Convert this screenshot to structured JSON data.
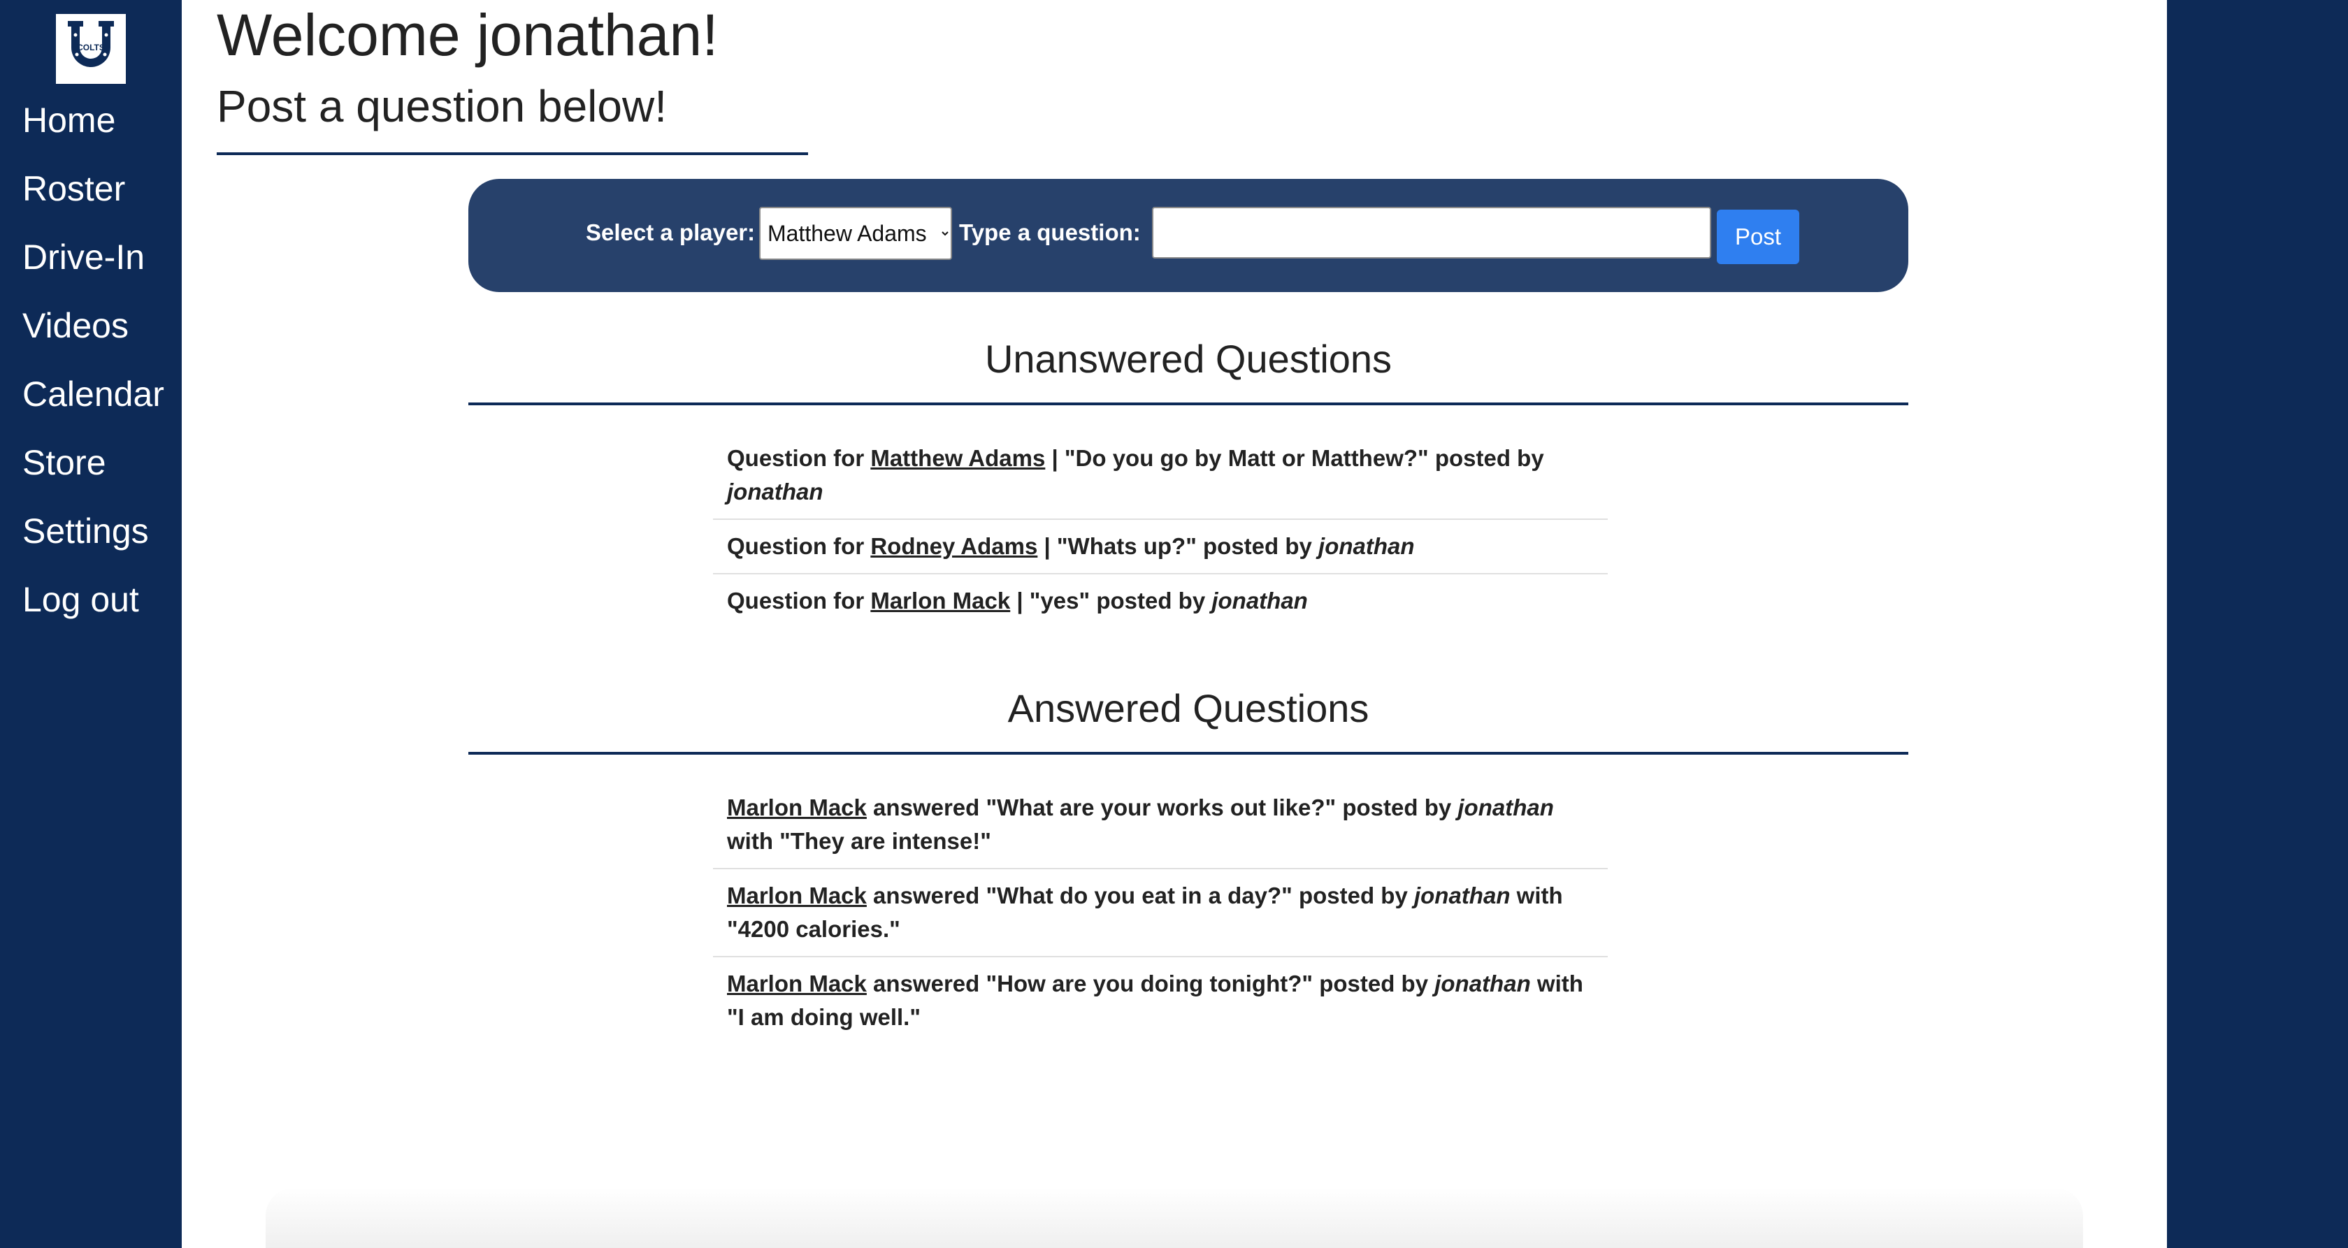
{
  "sidebar": {
    "logo_label": "COLTS",
    "items": [
      {
        "label": "Home"
      },
      {
        "label": "Roster"
      },
      {
        "label": "Drive-In"
      },
      {
        "label": "Videos"
      },
      {
        "label": "Calendar"
      },
      {
        "label": "Store"
      },
      {
        "label": "Settings"
      },
      {
        "label": "Log out"
      }
    ]
  },
  "header": {
    "welcome": "Welcome jonathan!",
    "subtitle": "Post a question below!"
  },
  "form": {
    "player_label": "Select a player:",
    "player_selected": "Matthew Adams",
    "question_label": "Type a question:",
    "question_value": "",
    "question_placeholder": "",
    "post_label": "Post"
  },
  "unanswered": {
    "title": "Unanswered Questions",
    "items": [
      {
        "prefix": "Question for ",
        "player": "Matthew Adams",
        "middle": " | \"Do you go by Matt or Matthew?\" posted by ",
        "user": "jonathan"
      },
      {
        "prefix": "Question for ",
        "player": "Rodney Adams",
        "middle": " | \"Whats up?\" posted by ",
        "user": "jonathan"
      },
      {
        "prefix": "Question for ",
        "player": "Marlon Mack",
        "middle": " | \"yes\" posted by ",
        "user": "jonathan"
      }
    ]
  },
  "answered": {
    "title": "Answered Questions",
    "items": [
      {
        "player": "Marlon Mack",
        "middle": " answered \"What are your works out like?\" posted by ",
        "user": "jonathan",
        "suffix": " with \"They are intense!\""
      },
      {
        "player": "Marlon Mack",
        "middle": " answered \"What do you eat in a day?\" posted by ",
        "user": "jonathan",
        "suffix": " with \"4200 calories.\""
      },
      {
        "player": "Marlon Mack",
        "middle": " answered \"How are you doing tonight?\" posted by ",
        "user": "jonathan",
        "suffix": " with \"I am doing well.\""
      }
    ]
  },
  "colors": {
    "navy": "#0d2a57",
    "form_bar": "#27416b",
    "post_button": "#2f7ff0"
  }
}
